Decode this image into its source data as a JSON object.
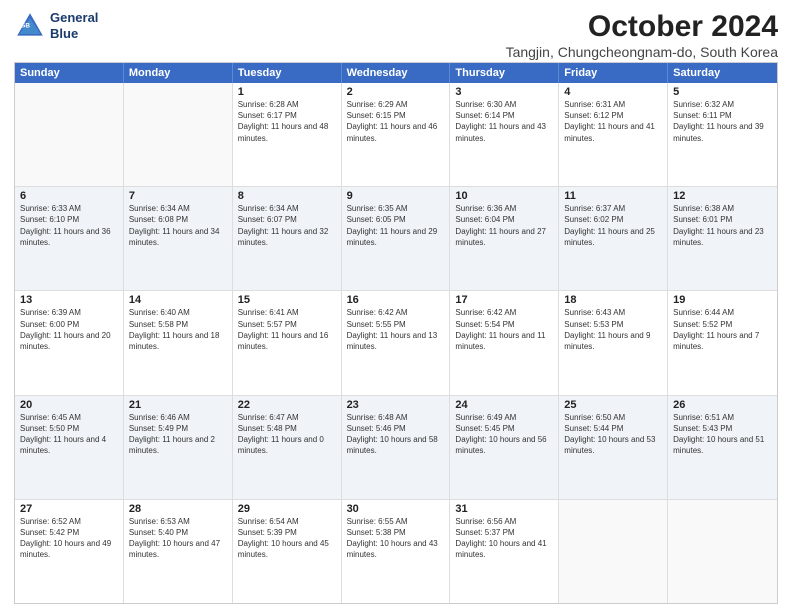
{
  "logo": {
    "line1": "General",
    "line2": "Blue"
  },
  "title": "October 2024",
  "subtitle": "Tangjin, Chungcheongnam-do, South Korea",
  "header_days": [
    "Sunday",
    "Monday",
    "Tuesday",
    "Wednesday",
    "Thursday",
    "Friday",
    "Saturday"
  ],
  "weeks": [
    [
      {
        "day": "",
        "sunrise": "",
        "sunset": "",
        "daylight": ""
      },
      {
        "day": "",
        "sunrise": "",
        "sunset": "",
        "daylight": ""
      },
      {
        "day": "1",
        "sunrise": "Sunrise: 6:28 AM",
        "sunset": "Sunset: 6:17 PM",
        "daylight": "Daylight: 11 hours and 48 minutes."
      },
      {
        "day": "2",
        "sunrise": "Sunrise: 6:29 AM",
        "sunset": "Sunset: 6:15 PM",
        "daylight": "Daylight: 11 hours and 46 minutes."
      },
      {
        "day": "3",
        "sunrise": "Sunrise: 6:30 AM",
        "sunset": "Sunset: 6:14 PM",
        "daylight": "Daylight: 11 hours and 43 minutes."
      },
      {
        "day": "4",
        "sunrise": "Sunrise: 6:31 AM",
        "sunset": "Sunset: 6:12 PM",
        "daylight": "Daylight: 11 hours and 41 minutes."
      },
      {
        "day": "5",
        "sunrise": "Sunrise: 6:32 AM",
        "sunset": "Sunset: 6:11 PM",
        "daylight": "Daylight: 11 hours and 39 minutes."
      }
    ],
    [
      {
        "day": "6",
        "sunrise": "Sunrise: 6:33 AM",
        "sunset": "Sunset: 6:10 PM",
        "daylight": "Daylight: 11 hours and 36 minutes."
      },
      {
        "day": "7",
        "sunrise": "Sunrise: 6:34 AM",
        "sunset": "Sunset: 6:08 PM",
        "daylight": "Daylight: 11 hours and 34 minutes."
      },
      {
        "day": "8",
        "sunrise": "Sunrise: 6:34 AM",
        "sunset": "Sunset: 6:07 PM",
        "daylight": "Daylight: 11 hours and 32 minutes."
      },
      {
        "day": "9",
        "sunrise": "Sunrise: 6:35 AM",
        "sunset": "Sunset: 6:05 PM",
        "daylight": "Daylight: 11 hours and 29 minutes."
      },
      {
        "day": "10",
        "sunrise": "Sunrise: 6:36 AM",
        "sunset": "Sunset: 6:04 PM",
        "daylight": "Daylight: 11 hours and 27 minutes."
      },
      {
        "day": "11",
        "sunrise": "Sunrise: 6:37 AM",
        "sunset": "Sunset: 6:02 PM",
        "daylight": "Daylight: 11 hours and 25 minutes."
      },
      {
        "day": "12",
        "sunrise": "Sunrise: 6:38 AM",
        "sunset": "Sunset: 6:01 PM",
        "daylight": "Daylight: 11 hours and 23 minutes."
      }
    ],
    [
      {
        "day": "13",
        "sunrise": "Sunrise: 6:39 AM",
        "sunset": "Sunset: 6:00 PM",
        "daylight": "Daylight: 11 hours and 20 minutes."
      },
      {
        "day": "14",
        "sunrise": "Sunrise: 6:40 AM",
        "sunset": "Sunset: 5:58 PM",
        "daylight": "Daylight: 11 hours and 18 minutes."
      },
      {
        "day": "15",
        "sunrise": "Sunrise: 6:41 AM",
        "sunset": "Sunset: 5:57 PM",
        "daylight": "Daylight: 11 hours and 16 minutes."
      },
      {
        "day": "16",
        "sunrise": "Sunrise: 6:42 AM",
        "sunset": "Sunset: 5:55 PM",
        "daylight": "Daylight: 11 hours and 13 minutes."
      },
      {
        "day": "17",
        "sunrise": "Sunrise: 6:42 AM",
        "sunset": "Sunset: 5:54 PM",
        "daylight": "Daylight: 11 hours and 11 minutes."
      },
      {
        "day": "18",
        "sunrise": "Sunrise: 6:43 AM",
        "sunset": "Sunset: 5:53 PM",
        "daylight": "Daylight: 11 hours and 9 minutes."
      },
      {
        "day": "19",
        "sunrise": "Sunrise: 6:44 AM",
        "sunset": "Sunset: 5:52 PM",
        "daylight": "Daylight: 11 hours and 7 minutes."
      }
    ],
    [
      {
        "day": "20",
        "sunrise": "Sunrise: 6:45 AM",
        "sunset": "Sunset: 5:50 PM",
        "daylight": "Daylight: 11 hours and 4 minutes."
      },
      {
        "day": "21",
        "sunrise": "Sunrise: 6:46 AM",
        "sunset": "Sunset: 5:49 PM",
        "daylight": "Daylight: 11 hours and 2 minutes."
      },
      {
        "day": "22",
        "sunrise": "Sunrise: 6:47 AM",
        "sunset": "Sunset: 5:48 PM",
        "daylight": "Daylight: 11 hours and 0 minutes."
      },
      {
        "day": "23",
        "sunrise": "Sunrise: 6:48 AM",
        "sunset": "Sunset: 5:46 PM",
        "daylight": "Daylight: 10 hours and 58 minutes."
      },
      {
        "day": "24",
        "sunrise": "Sunrise: 6:49 AM",
        "sunset": "Sunset: 5:45 PM",
        "daylight": "Daylight: 10 hours and 56 minutes."
      },
      {
        "day": "25",
        "sunrise": "Sunrise: 6:50 AM",
        "sunset": "Sunset: 5:44 PM",
        "daylight": "Daylight: 10 hours and 53 minutes."
      },
      {
        "day": "26",
        "sunrise": "Sunrise: 6:51 AM",
        "sunset": "Sunset: 5:43 PM",
        "daylight": "Daylight: 10 hours and 51 minutes."
      }
    ],
    [
      {
        "day": "27",
        "sunrise": "Sunrise: 6:52 AM",
        "sunset": "Sunset: 5:42 PM",
        "daylight": "Daylight: 10 hours and 49 minutes."
      },
      {
        "day": "28",
        "sunrise": "Sunrise: 6:53 AM",
        "sunset": "Sunset: 5:40 PM",
        "daylight": "Daylight: 10 hours and 47 minutes."
      },
      {
        "day": "29",
        "sunrise": "Sunrise: 6:54 AM",
        "sunset": "Sunset: 5:39 PM",
        "daylight": "Daylight: 10 hours and 45 minutes."
      },
      {
        "day": "30",
        "sunrise": "Sunrise: 6:55 AM",
        "sunset": "Sunset: 5:38 PM",
        "daylight": "Daylight: 10 hours and 43 minutes."
      },
      {
        "day": "31",
        "sunrise": "Sunrise: 6:56 AM",
        "sunset": "Sunset: 5:37 PM",
        "daylight": "Daylight: 10 hours and 41 minutes."
      },
      {
        "day": "",
        "sunrise": "",
        "sunset": "",
        "daylight": ""
      },
      {
        "day": "",
        "sunrise": "",
        "sunset": "",
        "daylight": ""
      }
    ]
  ]
}
